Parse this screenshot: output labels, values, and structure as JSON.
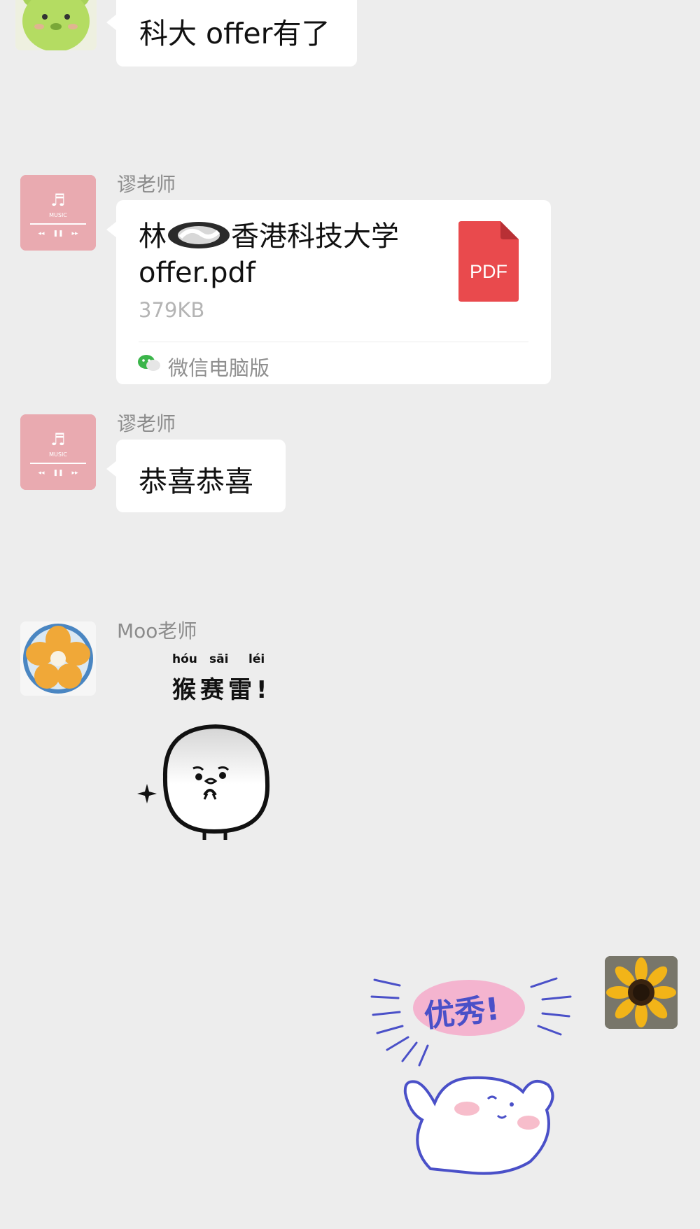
{
  "messages": [
    {
      "sender": "",
      "text": "科大 offer有了"
    },
    {
      "sender": "谬老师",
      "type": "file",
      "file_name": "林",
      "file_name_rest": "香港科技大学",
      "file_name_line2": "offer.pdf",
      "file_size": "379KB",
      "file_badge": "PDF",
      "source": "微信电脑版"
    },
    {
      "sender": "谬老师",
      "text": "恭喜恭喜"
    },
    {
      "sender": "Moo老师",
      "type": "sticker",
      "sticker_pinyin": [
        "hóu",
        "sāi",
        "léi"
      ],
      "sticker_text": "猴赛雷!"
    },
    {
      "sender": "",
      "type": "sticker",
      "sticker_text": "优秀!"
    }
  ],
  "avatars": {
    "music_label": "MUSIC"
  },
  "colors": {
    "background": "#ededed",
    "bubble": "#ffffff",
    "pdf_red": "#e94a4d",
    "wechat_green": "#3bb54a"
  }
}
